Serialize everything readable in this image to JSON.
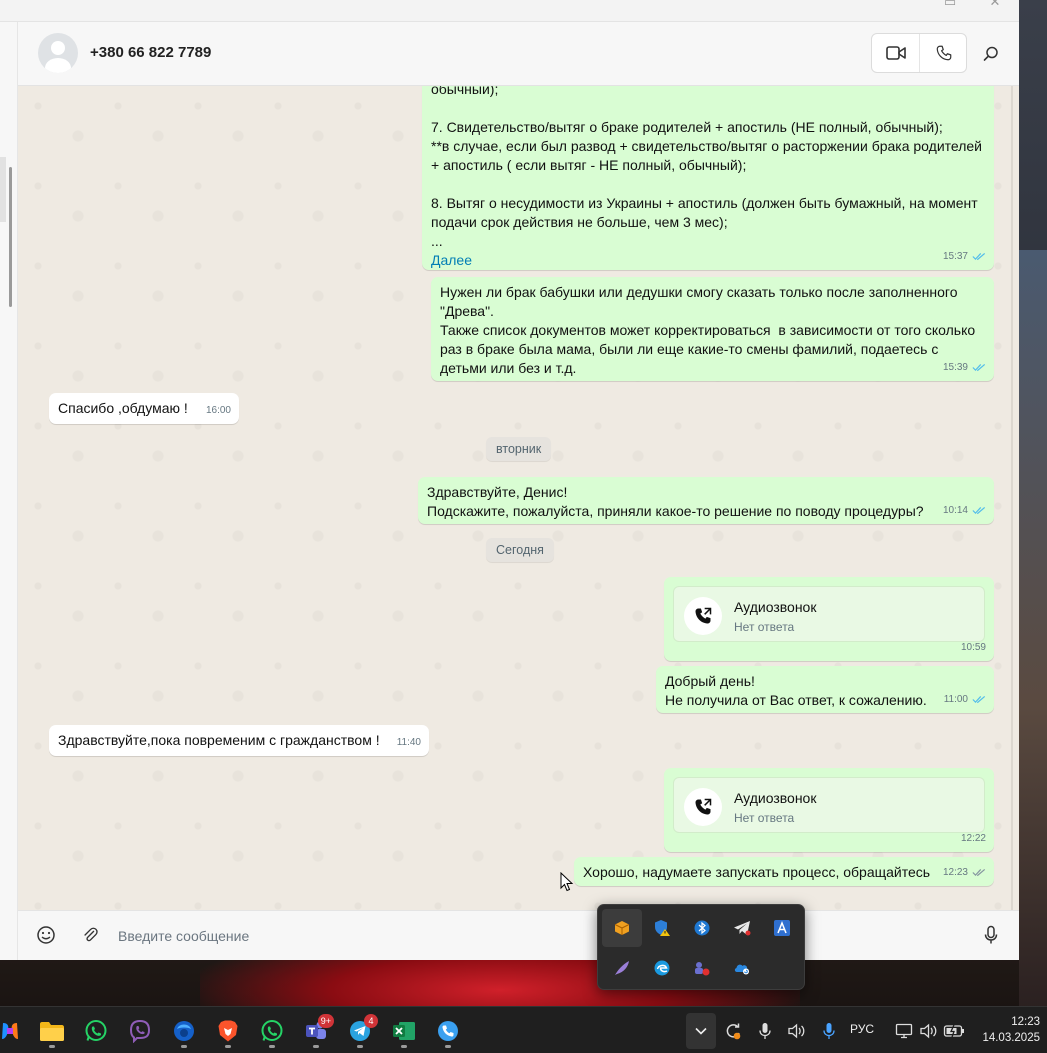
{
  "header": {
    "contact_name": "+380 66 822 7789"
  },
  "messages": [
    {
      "kind": "out",
      "text": "обычный);\n\n7. Свидетельство/вытяг о браке родителей + апостиль (НЕ полный, обычный);\n**в случае, если был развод + свидетельство/вытяг о расторжении брака родителей + апостиль ( если вытяг - НЕ полный, обычный);\n\n8. Вытяг о несудимости из Украины + апостиль (должен быть бумажный, на момент подачи срок действия не больше, чем 3 мес);\n...",
      "more": "Далее",
      "time": "15:37"
    },
    {
      "kind": "out",
      "text": "Нужен ли брак бабушки или дедушки смогу сказать только после заполненного \"Древа\".\nТакже список документов может корректироваться  в зависимости от того сколько раз в браке была мама, были ли еще какие-то смены фамилий, подаетесь с детьми или без и т.д.",
      "time": "15:39"
    },
    {
      "kind": "in",
      "text": "Спасибо ,обдумаю !",
      "time": "16:00"
    },
    {
      "kind": "date",
      "text": "вторник"
    },
    {
      "kind": "out",
      "text": "Здравствуйте, Денис!\nПодскажите, пожалуйста, приняли какое-то решение по поводу процедуры?",
      "time": "10:14"
    },
    {
      "kind": "date",
      "text": "Сегодня"
    },
    {
      "kind": "call",
      "title": "Аудиозвонок",
      "subtitle": "Нет ответа",
      "time": "10:59"
    },
    {
      "kind": "out",
      "text": "Добрый день!\nНе получила от Вас ответ, к сожалению.",
      "time": "11:00"
    },
    {
      "kind": "in",
      "text": "Здравствуйте,пока повременим с гражданством !",
      "time": "11:40"
    },
    {
      "kind": "call",
      "title": "Аудиозвонок",
      "subtitle": "Нет ответа",
      "time": "12:22"
    },
    {
      "kind": "out",
      "text": "Хорошо, надумаете запускать процесс, обращайтесь",
      "time": "12:23",
      "ticks": "grey"
    }
  ],
  "composer": {
    "placeholder": "Введите сообщение"
  },
  "taskbar": {
    "teams_badge": "9+",
    "telegram_badge": "4",
    "language": "РУС",
    "time": "12:23",
    "date": "14.03.2025"
  },
  "colors": {
    "outgoing_bubble": "#d9fdd3",
    "incoming_bubble": "#ffffff",
    "read_ticks": "#53bdeb",
    "chat_background": "#efeae2"
  }
}
